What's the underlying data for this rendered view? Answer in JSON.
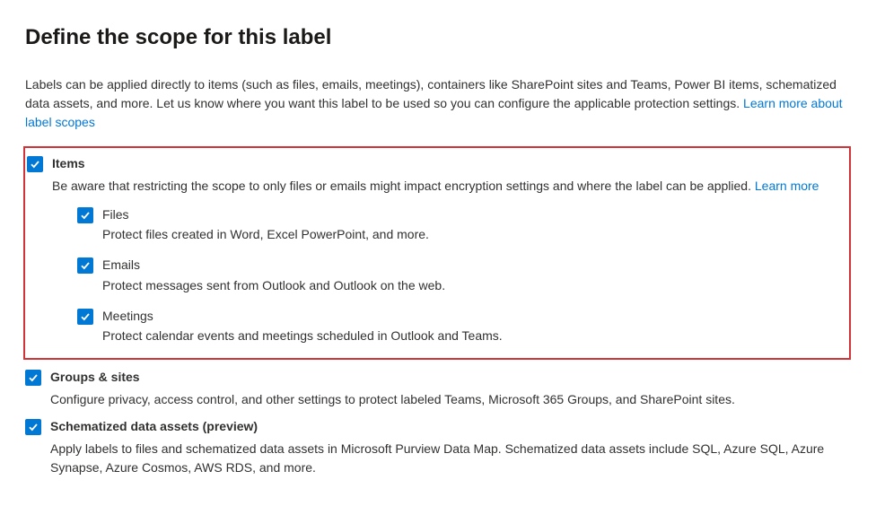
{
  "title": "Define the scope for this label",
  "intro_text": "Labels can be applied directly to items (such as files, emails, meetings), containers like SharePoint sites and Teams, Power BI items, schematized data assets, and more. Let us know where you want this label to be used so you can configure the applicable protection settings. ",
  "intro_link": "Learn more about label scopes",
  "items": {
    "label": "Items",
    "desc_text": "Be aware that restricting the scope to only files or emails might impact encryption settings and where the label can be applied. ",
    "desc_link": "Learn more",
    "subs": {
      "files": {
        "label": "Files",
        "desc": "Protect files created in Word, Excel PowerPoint, and more."
      },
      "emails": {
        "label": "Emails",
        "desc": "Protect messages sent from Outlook and Outlook on the web."
      },
      "meetings": {
        "label": "Meetings",
        "desc": "Protect calendar events and meetings scheduled in Outlook and Teams."
      }
    }
  },
  "groups": {
    "label": "Groups & sites",
    "desc": "Configure privacy, access control, and other settings to protect labeled Teams, Microsoft 365 Groups, and SharePoint sites."
  },
  "schematized": {
    "label": "Schematized data assets (preview)",
    "desc": "Apply labels to files and schematized data assets in Microsoft Purview Data Map. Schematized data assets include SQL, Azure SQL, Azure Synapse, Azure Cosmos, AWS RDS, and more."
  }
}
